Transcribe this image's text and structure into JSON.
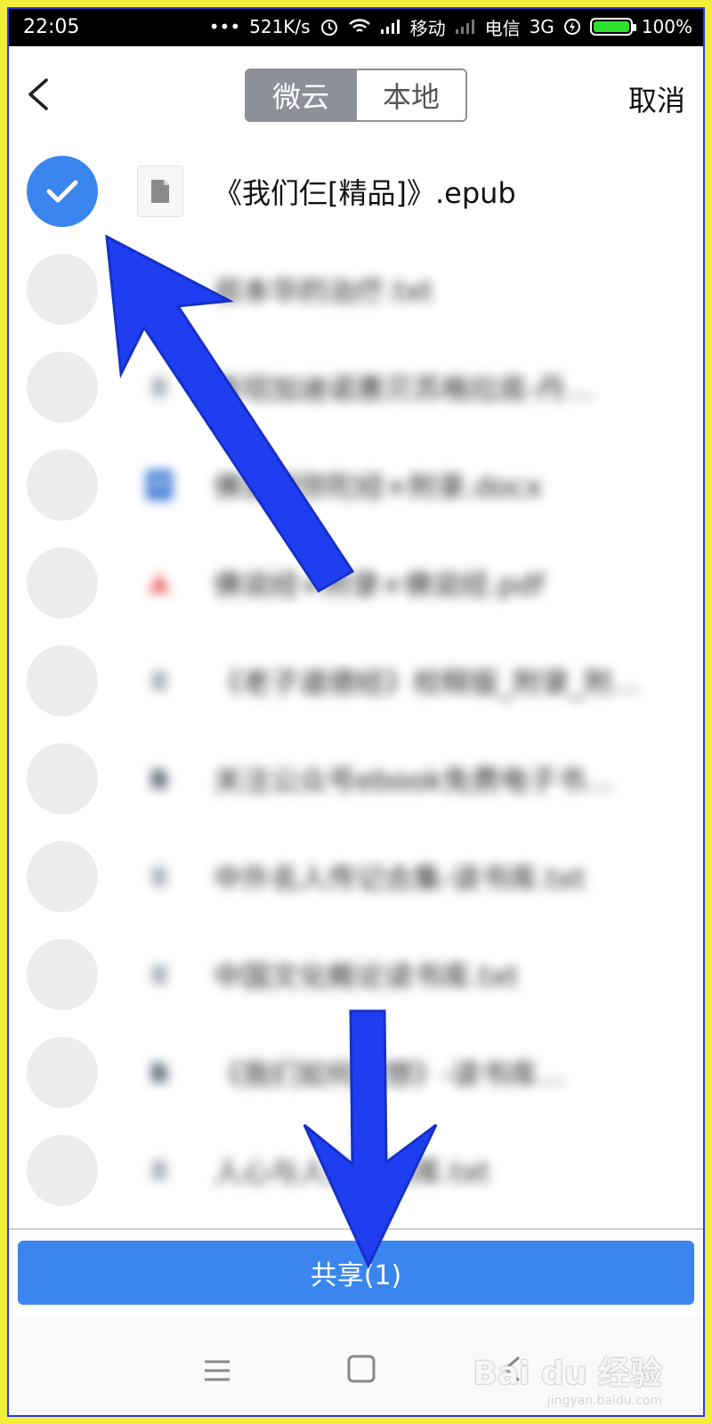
{
  "status_bar": {
    "time": "22:05",
    "dots": "•••",
    "speed": "521K/s",
    "carrier1": "移动",
    "carrier2": "电信",
    "network": "3G",
    "battery": "100%"
  },
  "header": {
    "tabs": [
      "微云",
      "本地"
    ],
    "active_tab": "微云",
    "cancel_label": "取消"
  },
  "files": [
    {
      "name": "《我们仨[精品]》.epub",
      "selected": true,
      "icon": "document-icon",
      "blurred": false
    },
    {
      "name": "叔本华的治疗.txt",
      "selected": false,
      "icon": "none",
      "blurred": true
    },
    {
      "name": "斯坦加迪诺惠贝苏格拉底-丹…",
      "selected": false,
      "icon": "document-icon",
      "blurred": true
    },
    {
      "name": "佛说阿弥陀经+附录.docx",
      "selected": false,
      "icon": "word-icon",
      "blurred": true
    },
    {
      "name": "佛说经+附录+佛说经.pdf",
      "selected": false,
      "icon": "pdf-icon",
      "blurred": true
    },
    {
      "name": "《老子道德经》校释版_附录_附…",
      "selected": false,
      "icon": "document-icon",
      "blurred": true
    },
    {
      "name": "关注公众号ebook免费电子书…",
      "selected": false,
      "icon": "file-icon",
      "blurred": true
    },
    {
      "name": "中外名人传记合集-读书库.txt",
      "selected": false,
      "icon": "document-icon",
      "blurred": true
    },
    {
      "name": "中国文化概论读书库.txt",
      "selected": false,
      "icon": "document-icon",
      "blurred": true
    },
    {
      "name": "《我们如何思想》-读书库…",
      "selected": false,
      "icon": "file-icon",
      "blurred": true
    },
    {
      "name": "人心与人生读书库.txt",
      "selected": false,
      "icon": "document-icon",
      "blurred": true
    }
  ],
  "share_button": {
    "label": "共享(1)"
  },
  "watermark": {
    "text": "Bai du 经验",
    "sub": "jingyan.baidu.com"
  }
}
